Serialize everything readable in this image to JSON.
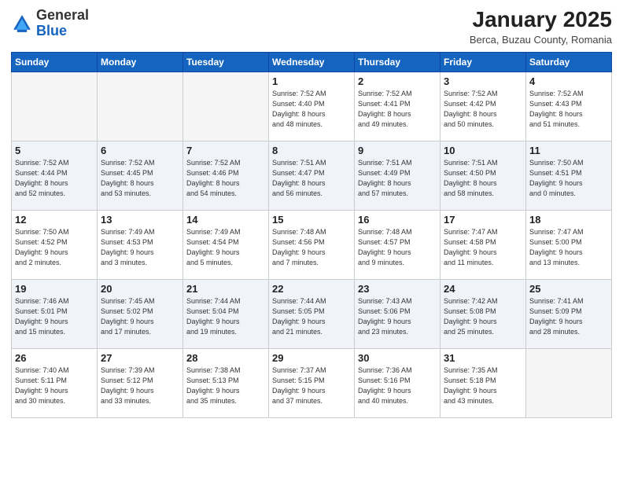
{
  "header": {
    "logo_general": "General",
    "logo_blue": "Blue",
    "month": "January 2025",
    "location": "Berca, Buzau County, Romania"
  },
  "weekdays": [
    "Sunday",
    "Monday",
    "Tuesday",
    "Wednesday",
    "Thursday",
    "Friday",
    "Saturday"
  ],
  "weeks": [
    [
      {
        "day": "",
        "info": ""
      },
      {
        "day": "",
        "info": ""
      },
      {
        "day": "",
        "info": ""
      },
      {
        "day": "1",
        "info": "Sunrise: 7:52 AM\nSunset: 4:40 PM\nDaylight: 8 hours\nand 48 minutes."
      },
      {
        "day": "2",
        "info": "Sunrise: 7:52 AM\nSunset: 4:41 PM\nDaylight: 8 hours\nand 49 minutes."
      },
      {
        "day": "3",
        "info": "Sunrise: 7:52 AM\nSunset: 4:42 PM\nDaylight: 8 hours\nand 50 minutes."
      },
      {
        "day": "4",
        "info": "Sunrise: 7:52 AM\nSunset: 4:43 PM\nDaylight: 8 hours\nand 51 minutes."
      }
    ],
    [
      {
        "day": "5",
        "info": "Sunrise: 7:52 AM\nSunset: 4:44 PM\nDaylight: 8 hours\nand 52 minutes."
      },
      {
        "day": "6",
        "info": "Sunrise: 7:52 AM\nSunset: 4:45 PM\nDaylight: 8 hours\nand 53 minutes."
      },
      {
        "day": "7",
        "info": "Sunrise: 7:52 AM\nSunset: 4:46 PM\nDaylight: 8 hours\nand 54 minutes."
      },
      {
        "day": "8",
        "info": "Sunrise: 7:51 AM\nSunset: 4:47 PM\nDaylight: 8 hours\nand 56 minutes."
      },
      {
        "day": "9",
        "info": "Sunrise: 7:51 AM\nSunset: 4:49 PM\nDaylight: 8 hours\nand 57 minutes."
      },
      {
        "day": "10",
        "info": "Sunrise: 7:51 AM\nSunset: 4:50 PM\nDaylight: 8 hours\nand 58 minutes."
      },
      {
        "day": "11",
        "info": "Sunrise: 7:50 AM\nSunset: 4:51 PM\nDaylight: 9 hours\nand 0 minutes."
      }
    ],
    [
      {
        "day": "12",
        "info": "Sunrise: 7:50 AM\nSunset: 4:52 PM\nDaylight: 9 hours\nand 2 minutes."
      },
      {
        "day": "13",
        "info": "Sunrise: 7:49 AM\nSunset: 4:53 PM\nDaylight: 9 hours\nand 3 minutes."
      },
      {
        "day": "14",
        "info": "Sunrise: 7:49 AM\nSunset: 4:54 PM\nDaylight: 9 hours\nand 5 minutes."
      },
      {
        "day": "15",
        "info": "Sunrise: 7:48 AM\nSunset: 4:56 PM\nDaylight: 9 hours\nand 7 minutes."
      },
      {
        "day": "16",
        "info": "Sunrise: 7:48 AM\nSunset: 4:57 PM\nDaylight: 9 hours\nand 9 minutes."
      },
      {
        "day": "17",
        "info": "Sunrise: 7:47 AM\nSunset: 4:58 PM\nDaylight: 9 hours\nand 11 minutes."
      },
      {
        "day": "18",
        "info": "Sunrise: 7:47 AM\nSunset: 5:00 PM\nDaylight: 9 hours\nand 13 minutes."
      }
    ],
    [
      {
        "day": "19",
        "info": "Sunrise: 7:46 AM\nSunset: 5:01 PM\nDaylight: 9 hours\nand 15 minutes."
      },
      {
        "day": "20",
        "info": "Sunrise: 7:45 AM\nSunset: 5:02 PM\nDaylight: 9 hours\nand 17 minutes."
      },
      {
        "day": "21",
        "info": "Sunrise: 7:44 AM\nSunset: 5:04 PM\nDaylight: 9 hours\nand 19 minutes."
      },
      {
        "day": "22",
        "info": "Sunrise: 7:44 AM\nSunset: 5:05 PM\nDaylight: 9 hours\nand 21 minutes."
      },
      {
        "day": "23",
        "info": "Sunrise: 7:43 AM\nSunset: 5:06 PM\nDaylight: 9 hours\nand 23 minutes."
      },
      {
        "day": "24",
        "info": "Sunrise: 7:42 AM\nSunset: 5:08 PM\nDaylight: 9 hours\nand 25 minutes."
      },
      {
        "day": "25",
        "info": "Sunrise: 7:41 AM\nSunset: 5:09 PM\nDaylight: 9 hours\nand 28 minutes."
      }
    ],
    [
      {
        "day": "26",
        "info": "Sunrise: 7:40 AM\nSunset: 5:11 PM\nDaylight: 9 hours\nand 30 minutes."
      },
      {
        "day": "27",
        "info": "Sunrise: 7:39 AM\nSunset: 5:12 PM\nDaylight: 9 hours\nand 33 minutes."
      },
      {
        "day": "28",
        "info": "Sunrise: 7:38 AM\nSunset: 5:13 PM\nDaylight: 9 hours\nand 35 minutes."
      },
      {
        "day": "29",
        "info": "Sunrise: 7:37 AM\nSunset: 5:15 PM\nDaylight: 9 hours\nand 37 minutes."
      },
      {
        "day": "30",
        "info": "Sunrise: 7:36 AM\nSunset: 5:16 PM\nDaylight: 9 hours\nand 40 minutes."
      },
      {
        "day": "31",
        "info": "Sunrise: 7:35 AM\nSunset: 5:18 PM\nDaylight: 9 hours\nand 43 minutes."
      },
      {
        "day": "",
        "info": ""
      }
    ]
  ],
  "empty_rows": [
    0,
    2,
    4
  ]
}
